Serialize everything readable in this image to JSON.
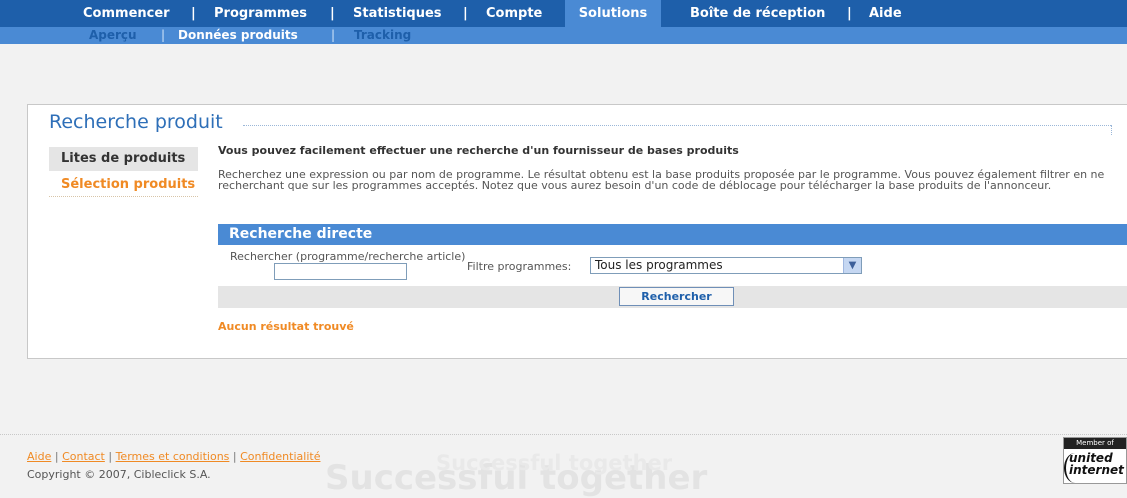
{
  "main_nav": {
    "items": [
      {
        "label": "Commencer"
      },
      {
        "label": "Programmes"
      },
      {
        "label": "Statistiques"
      },
      {
        "label": "Compte"
      },
      {
        "label": "Solutions"
      },
      {
        "label": "Boîte de réception"
      },
      {
        "label": "Aide"
      }
    ],
    "separator": "|",
    "active": "Solutions"
  },
  "sub_nav": {
    "items": [
      {
        "label": "Aperçu"
      },
      {
        "label": "Données produits"
      },
      {
        "label": "Tracking"
      }
    ],
    "separator": "|"
  },
  "page": {
    "title": "Recherche produit"
  },
  "sidebar": {
    "items": [
      {
        "label": "Lites de produits"
      },
      {
        "label": "Sélection produits"
      }
    ]
  },
  "content": {
    "intro": "Vous pouvez facilement effectuer une recherche d'un fournisseur de bases produits",
    "description": "Recherchez une expression ou par nom de programme. Le résultat obtenu est la base produits proposée par le programme. Vous pouvez également filtrer en ne recherchant que sur les programmes acceptés. Notez que vous aurez besoin d'un code de déblocage pour télécharger la base produits de l'annonceur."
  },
  "search": {
    "header": "Recherche directe",
    "search_label": "Rechercher (programme/recherche article)",
    "search_value": "",
    "filter_label": "Filtre programmes:",
    "filter_selected": "Tous les programmes",
    "button_label": "Rechercher"
  },
  "results": {
    "message": "Aucun résultat trouvé"
  },
  "footer": {
    "links": [
      {
        "label": "Aide"
      },
      {
        "label": "Contact"
      },
      {
        "label": "Termes et conditions"
      },
      {
        "label": "Confidentialité"
      }
    ],
    "separator": "|",
    "copyright": "Copyright © 2007,  Cibleclick S.A.",
    "watermark": "Successful together",
    "badge": {
      "top": "Member of",
      "line1": "united",
      "line2": "internet"
    }
  },
  "colors": {
    "nav_blue": "#1e5faa",
    "nav_light": "#4a8ad4",
    "accent_orange": "#f08a24",
    "title_blue": "#2e6fb8"
  }
}
